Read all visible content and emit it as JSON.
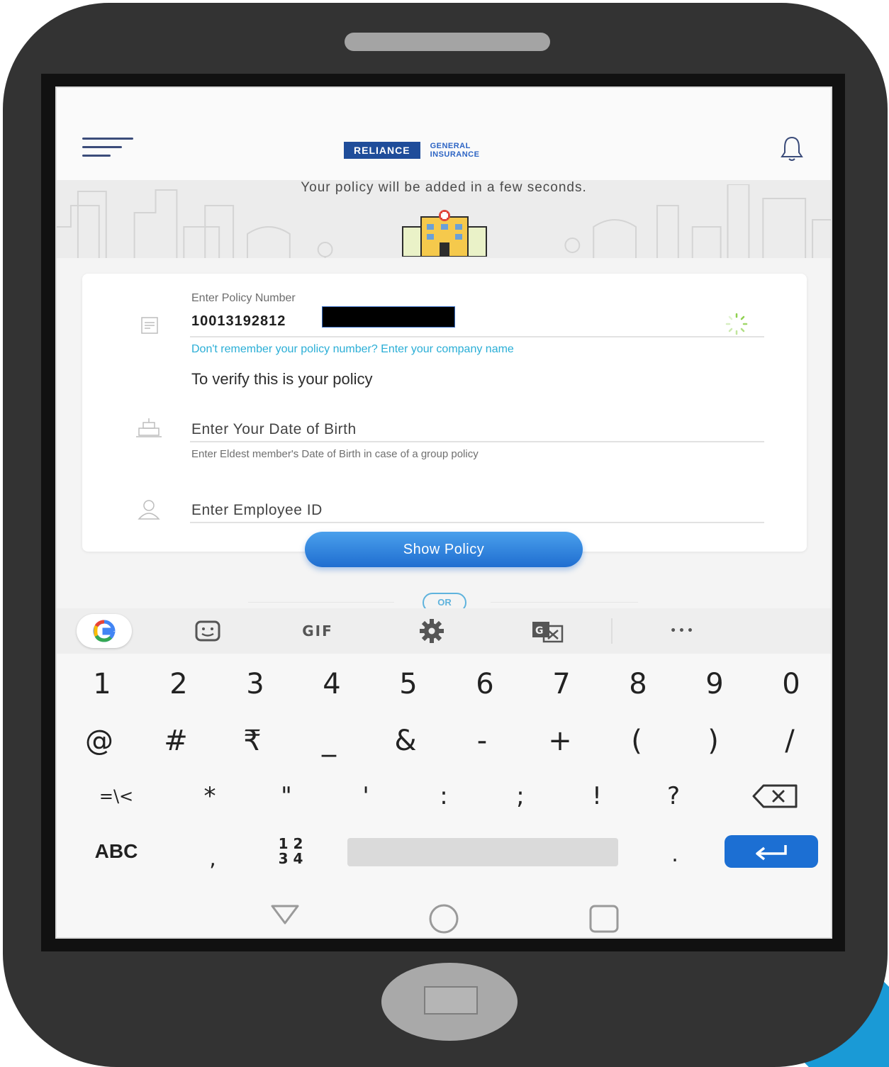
{
  "appbar": {
    "logo_primary": "RELIANCE",
    "logo_secondary_line1": "GENERAL",
    "logo_secondary_line2": "INSURANCE"
  },
  "hero": {
    "message": "Your policy will be added in a few seconds."
  },
  "form": {
    "policy_label": "Enter Policy Number",
    "policy_value_visible": "10013192812",
    "forgot_link": "Don't remember your policy number? Enter your company name",
    "verify_heading": "To verify this is your policy",
    "dob_placeholder": "Enter Your Date of Birth",
    "dob_hint": "Enter Eldest member's Date of Birth in case of a group policy",
    "employee_placeholder": "Enter Employee ID",
    "submit_label": "Show Policy",
    "or_label": "OR"
  },
  "keyboard": {
    "toolbar": {
      "gif_label": "GIF",
      "more_label": "•••"
    },
    "row1": [
      "1",
      "2",
      "3",
      "4",
      "5",
      "6",
      "7",
      "8",
      "9",
      "0"
    ],
    "row2": [
      "@",
      "#",
      "₹",
      "_",
      "&",
      "-",
      "+",
      "(",
      ")",
      "/"
    ],
    "row3": [
      "=\\<",
      "*",
      "\"",
      "'",
      ":",
      ";",
      "!",
      "?"
    ],
    "abc_label": "ABC",
    "comma_label": ",",
    "numpad_top": "1 2",
    "numpad_bottom": "3 4",
    "period_label": "."
  },
  "colors": {
    "brand_blue": "#1f4d9a",
    "button_blue": "#1f6ed0",
    "link_cyan": "#2aaed6",
    "phone_body": "#333333"
  }
}
